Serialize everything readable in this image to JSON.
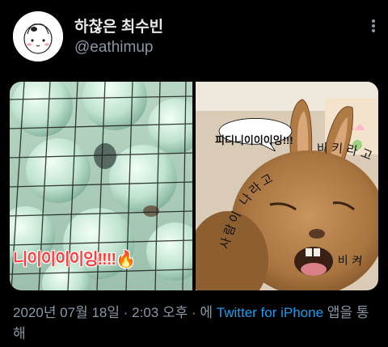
{
  "tweet": {
    "display_name": "하찮은 최수빈",
    "handle": "@eathimup",
    "more_icon": "more-vertical-icon"
  },
  "media": {
    "left_caption": "니이이이이잉!!!!",
    "left_emoji": "🔥",
    "right_bubble_text": "피디니이이이잉!!!",
    "right_curved_text_1": "사람이 나라고",
    "right_curved_text_2": "비키라고",
    "right_curved_text_3": "비켜"
  },
  "meta": {
    "date": "2020년 07월 18일",
    "sep1": "·",
    "time": "2:03 오후",
    "sep2": "·",
    "via_prefix": "에",
    "source": "Twitter for iPhone",
    "via_suffix": "앱을 통해"
  },
  "colors": {
    "background": "#000000",
    "text": "#e7e9ea",
    "muted": "#8b98a5",
    "link": "#1d9bf0",
    "caption": "#ff3d3d"
  }
}
